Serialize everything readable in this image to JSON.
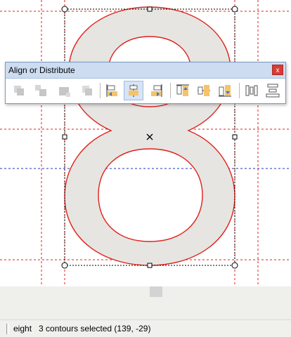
{
  "palette": {
    "title": "Align or Distribute",
    "close_glyph": "x",
    "tools": [
      {
        "name": "align-group-1",
        "icon": "align-objects-disabled-icon",
        "enabled": false
      },
      {
        "name": "align-group-2",
        "icon": "align-objects-disabled-icon",
        "enabled": false
      },
      {
        "name": "align-group-3",
        "icon": "align-objects-disabled-icon",
        "enabled": false
      },
      {
        "name": "align-group-4",
        "icon": "align-objects-disabled-icon",
        "enabled": false
      },
      {
        "name": "align-left",
        "icon": "align-left-icon",
        "enabled": true
      },
      {
        "name": "align-center-horizontal",
        "icon": "align-center-horizontal-icon",
        "enabled": true,
        "active": true
      },
      {
        "name": "align-right",
        "icon": "align-right-icon",
        "enabled": true
      },
      {
        "name": "align-top",
        "icon": "align-top-icon",
        "enabled": true
      },
      {
        "name": "align-center-vertical",
        "icon": "align-center-vertical-icon",
        "enabled": true
      },
      {
        "name": "align-bottom",
        "icon": "align-bottom-icon",
        "enabled": true
      },
      {
        "name": "distribute-horizontal",
        "icon": "distribute-horizontal-icon",
        "enabled": true
      },
      {
        "name": "distribute-vertical",
        "icon": "distribute-vertical-icon",
        "enabled": true
      }
    ]
  },
  "canvas": {
    "glyph_char": "8",
    "glyph_fill": "#e6e5e2",
    "outline_color": "#e0201a",
    "guide_color_red": "#e0201a",
    "guide_color_blue": "#2233bb"
  },
  "status": {
    "glyph_name": "eight",
    "message": "3 contours selected (139, -29)"
  }
}
